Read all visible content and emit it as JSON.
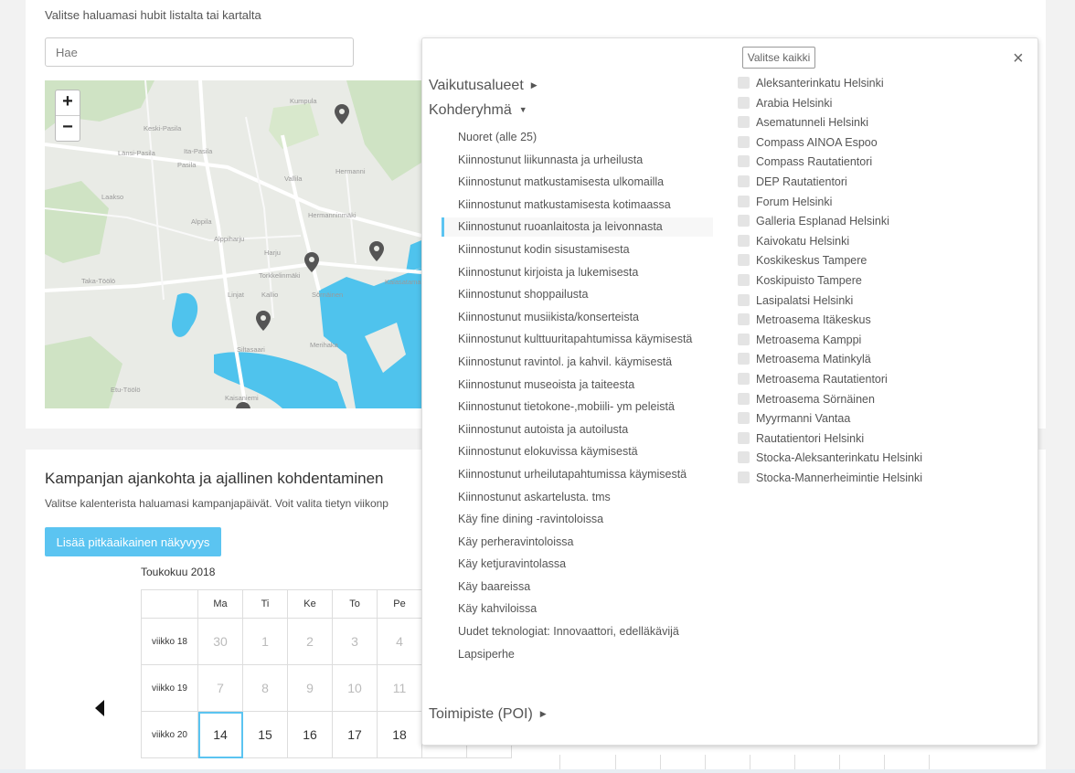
{
  "hubs": {
    "hint": "Valitse haluamasi hubit listalta tai kartalta",
    "search_placeholder": "Hae",
    "map": {
      "zoom_in": "+",
      "zoom_out": "−"
    }
  },
  "campaign": {
    "title": "Kampanjan ajankohta ja ajallinen kohdentaminen",
    "description": "Valitse kalenterista haluamasi kampanjapäivät. Voit valita tietyn viikonp",
    "long_visibility_button": "Lisää pitkäaikainen näkyvyys",
    "month": "Toukokuu 2018",
    "weekdays": [
      "Ma",
      "Ti",
      "Ke",
      "To",
      "Pe"
    ],
    "weeks": [
      {
        "label": "viikko 18",
        "days": [
          "30",
          "1",
          "2",
          "3",
          "4"
        ]
      },
      {
        "label": "viikko 19",
        "days": [
          "7",
          "8",
          "9",
          "10",
          "11"
        ]
      },
      {
        "label": "viikko 20",
        "days": [
          "14",
          "15",
          "16",
          "17",
          "18"
        ]
      }
    ]
  },
  "popup": {
    "select_all": "Valitse kaikki",
    "close": "×",
    "section_areas": "Vaikutusalueet",
    "section_target": "Kohderyhmä",
    "section_poi": "Toimipiste (POI)",
    "target_groups": [
      "Nuoret (alle 25)",
      "Kiinnostunut liikunnasta ja urheilusta",
      "Kiinnostunut matkustamisesta ulkomailla",
      "Kiinnostunut matkustamisesta kotimaassa",
      "Kiinnostunut ruoanlaitosta ja leivonnasta",
      "Kiinnostunut kodin sisustamisesta",
      "Kiinnostunut kirjoista ja lukemisesta",
      "Kiinnostunut shoppailusta",
      "Kiinnostunut musiikista/konserteista",
      "Kiinnostunut kulttuuritapahtumissa käymisestä",
      "Kiinnostunut ravintol. ja kahvil. käymisestä",
      "Kiinnostunut museoista ja taiteesta",
      "Kiinnostunut tietokone-,mobiili- ym peleistä",
      "Kiinnostunut autoista ja autoilusta",
      "Kiinnostunut elokuvissa käymisestä",
      "Kiinnostunut urheilutapahtumissa käymisestä",
      "Kiinnostunut askartelusta. tms",
      "Käy fine dining -ravintoloissa",
      "Käy perheravintoloissa",
      "Käy ketjuravintolassa",
      "Käy baareissa",
      "Käy kahviloissa",
      "Uudet teknologiat: Innovaattori, edelläkävijä",
      "Lapsiperhe"
    ],
    "active_target_index": 4,
    "locations": [
      "Aleksanterinkatu Helsinki",
      "Arabia Helsinki",
      "Asematunneli Helsinki",
      "Compass AINOA Espoo",
      "Compass Rautatientori",
      "DEP Rautatientori",
      "Forum Helsinki",
      "Galleria Esplanad Helsinki",
      "Kaivokatu Helsinki",
      "Koskikeskus Tampere",
      "Koskipuisto Tampere",
      "Lasipalatsi Helsinki",
      "Metroasema Itäkeskus",
      "Metroasema Kamppi",
      "Metroasema Matinkylä",
      "Metroasema Rautatientori",
      "Metroasema Sörnäinen",
      "Myyrmanni Vantaa",
      "Rautatientori Helsinki",
      "Stocka-Aleksanterinkatu Helsinki",
      "Stocka-Mannerheimintie Helsinki"
    ]
  },
  "colors": {
    "accent": "#5bc4f1",
    "water": "#4fc3ed",
    "park": "#c9e0bd",
    "land": "#e9ebe6"
  }
}
